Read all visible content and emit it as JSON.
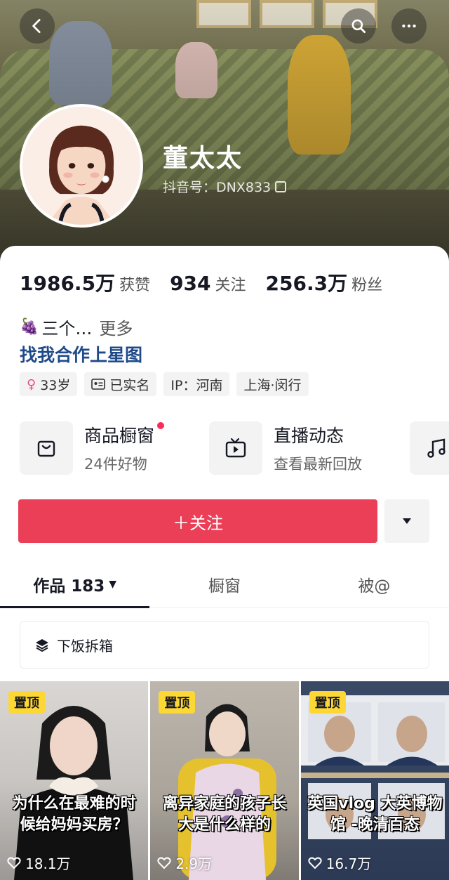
{
  "profile": {
    "name": "董太太",
    "douyin_id": "抖音号：DNX833"
  },
  "stats": [
    {
      "value": "1986.5万",
      "label": "获赞"
    },
    {
      "value": "934",
      "label": "关注"
    },
    {
      "value": "256.3万",
      "label": "粉丝"
    }
  ],
  "bio": {
    "emoji": "🍇",
    "text": "三个…",
    "more": "更多",
    "link": "找我合作上星图"
  },
  "tags": [
    {
      "icon": "female-icon",
      "text": "33岁"
    },
    {
      "icon": "id-card-icon",
      "text": "已实名"
    },
    {
      "icon": "",
      "text": "IP：河南"
    },
    {
      "icon": "",
      "text": "上海·闵行"
    }
  ],
  "services": [
    {
      "title": "商品橱窗",
      "subtitle": "24件好物",
      "icon": "shopping-bag-icon"
    },
    {
      "title": "直播动态",
      "subtitle": "查看最新回放",
      "icon": "tv-icon"
    }
  ],
  "actions": {
    "follow": "＋关注"
  },
  "tabs": [
    {
      "label": "作品 183"
    },
    {
      "label": "橱窗"
    },
    {
      "label": "被@"
    }
  ],
  "collection": {
    "label": "下饭拆箱"
  },
  "videos": [
    {
      "pinned": "置顶",
      "caption": "为什么在最难的时候给妈妈买房？",
      "likes": "18.1万"
    },
    {
      "pinned": "置顶",
      "caption": "离异家庭的孩子长大是什么样的",
      "likes": "2.9万"
    },
    {
      "pinned": "置顶",
      "caption": "英国vlog 大英博物馆 -晚清百态",
      "likes": "16.7万"
    }
  ],
  "colors": {
    "follow_button": "#ea3f57",
    "link": "#1f4a8a",
    "pin_badge": "#fdd835",
    "notify_dot": "#fe2c55"
  }
}
